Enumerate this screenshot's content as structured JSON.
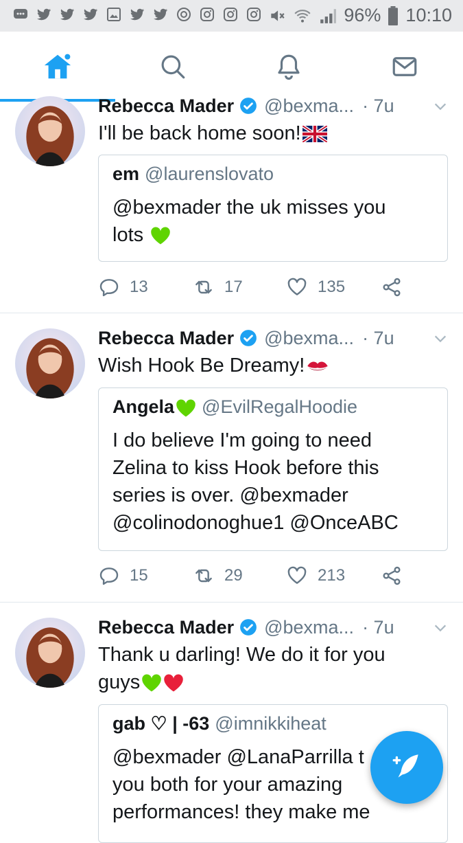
{
  "status_bar": {
    "battery": "96%",
    "time": "10:10",
    "notification_icons": [
      "message-icon",
      "twitter-icon",
      "twitter-icon",
      "twitter-icon",
      "gallery-icon",
      "twitter-icon",
      "twitter-icon",
      "sync-icon",
      "instagram-icon",
      "instagram-icon",
      "instagram-icon"
    ]
  },
  "tabs": [
    {
      "name": "home",
      "active": true
    },
    {
      "name": "search",
      "active": false
    },
    {
      "name": "notifications",
      "active": false
    },
    {
      "name": "messages",
      "active": false
    }
  ],
  "accent_color": "#1da1f2",
  "tweets": [
    {
      "name": "Rebecca Mader",
      "handle": "@bexma...",
      "time": "· 7u",
      "text": "I'll be back home soon!",
      "text_emoji": "uk-flag",
      "quote": {
        "name": "em",
        "handle": "@laurenslovato",
        "line1": "@bexmader the uk misses you",
        "line2": "lots",
        "emoji": "green-heart"
      },
      "replies": "13",
      "retweets": "17",
      "likes": "135"
    },
    {
      "name": "Rebecca Mader",
      "handle": "@bexma...",
      "time": "· 7u",
      "text": "Wish Hook Be Dreamy!",
      "text_emoji": "kiss-mark",
      "quote": {
        "name": "Angela",
        "name_emoji": "green-heart",
        "handle": "@EvilRegalHoodie",
        "line1": "I do believe I'm going to need",
        "line2": "Zelina to kiss Hook before this",
        "line3": "series is over. @bexmader",
        "line4": "@colinodonoghue1 @OnceABC"
      },
      "replies": "15",
      "retweets": "29",
      "likes": "213"
    },
    {
      "name": "Rebecca Mader",
      "handle": "@bexma...",
      "time": "· 7u",
      "text_line1": "Thank u darling! We do it for you",
      "text_line2": "guys",
      "text_emoji": [
        "green-heart",
        "red-heart"
      ],
      "quote": {
        "name": "gab ♡ | -63",
        "handle": "@imnikkiheat",
        "line1": "@bexmader @LanaParrilla t",
        "line2": "you both for your amazing",
        "line3": "performances! they make me"
      }
    }
  ]
}
